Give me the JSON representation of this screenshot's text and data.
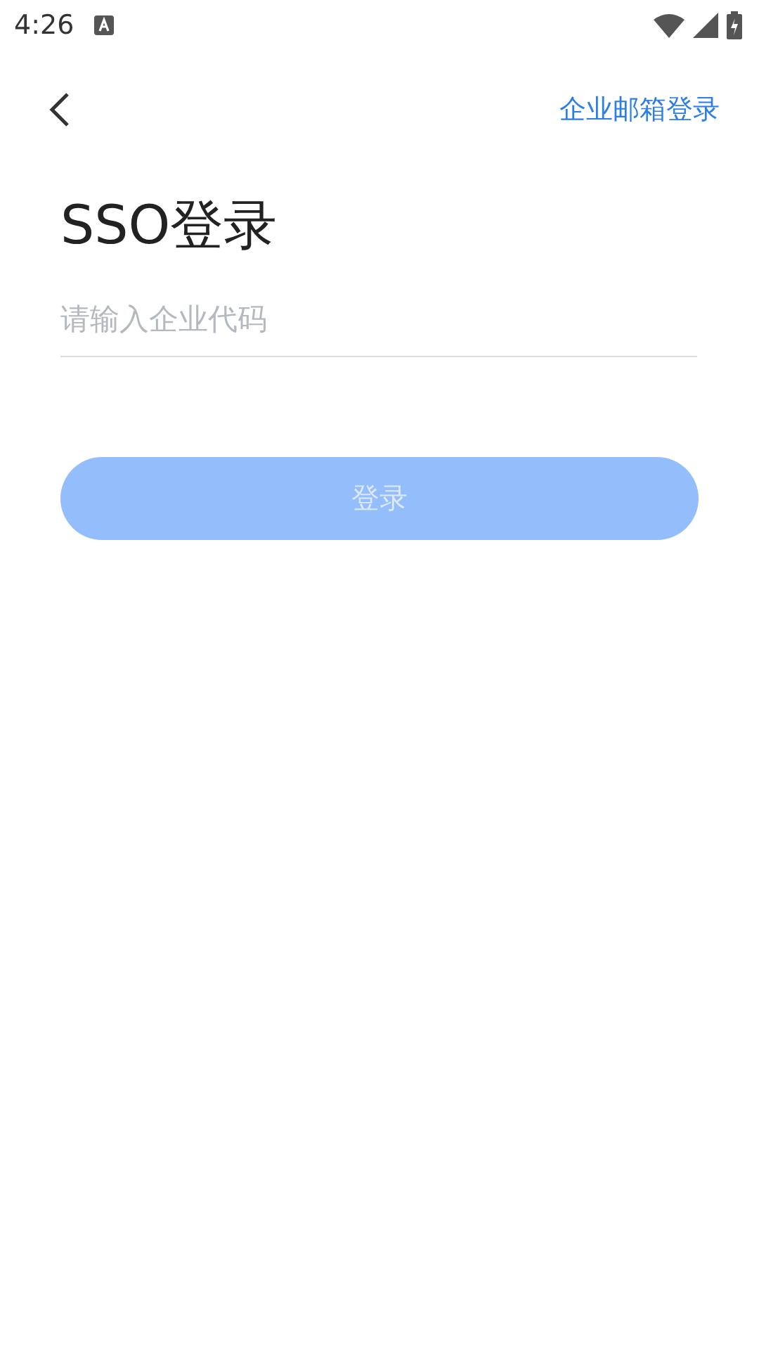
{
  "status_bar": {
    "time": "4:26"
  },
  "header": {
    "link": "企业邮箱登录"
  },
  "title": "SSO登录",
  "code_field": {
    "placeholder": "请输入企业代码"
  },
  "login_button": {
    "label": "登录",
    "disabled": true
  }
}
